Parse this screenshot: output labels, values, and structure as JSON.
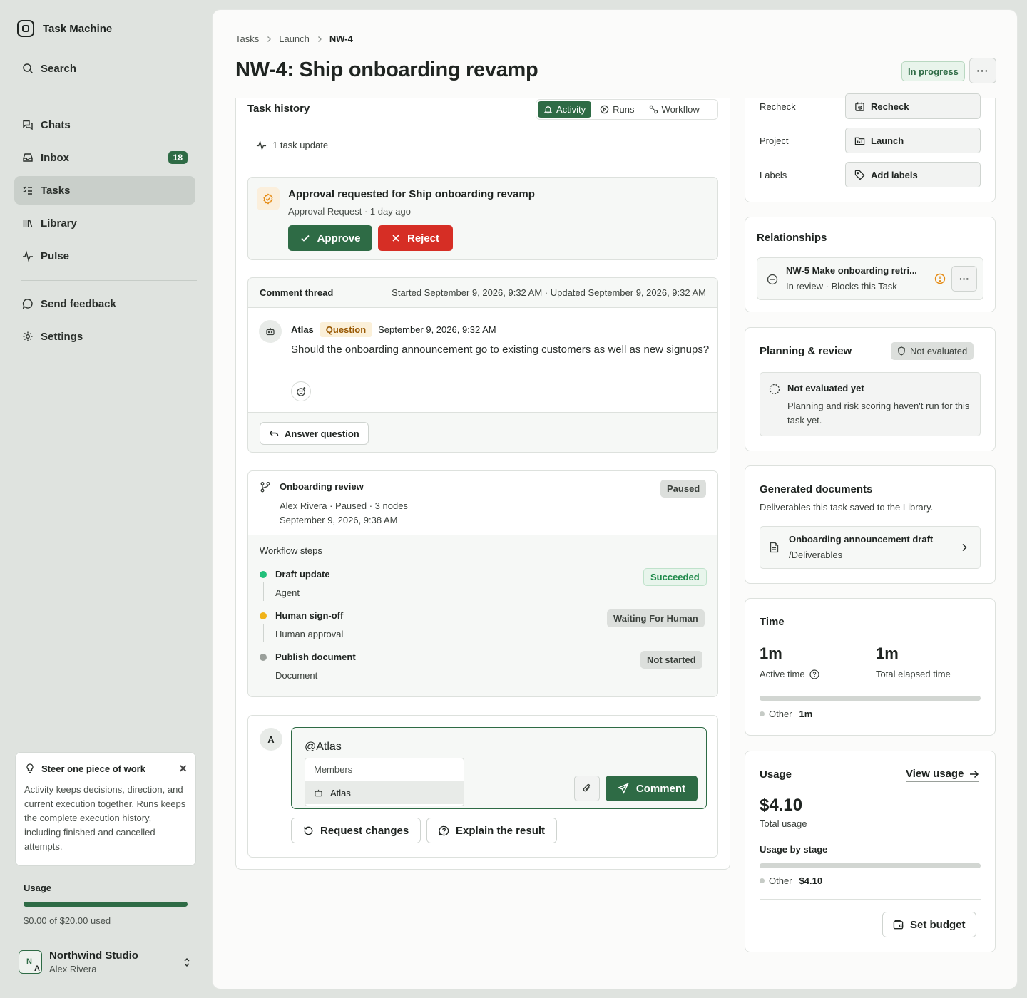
{
  "app": {
    "name": "Task Machine"
  },
  "sidebar": {
    "search_label": "Search",
    "items": [
      {
        "label": "Chats"
      },
      {
        "label": "Inbox",
        "badge": "18"
      },
      {
        "label": "Tasks"
      },
      {
        "label": "Library"
      },
      {
        "label": "Pulse"
      }
    ],
    "secondary": [
      {
        "label": "Send feedback"
      },
      {
        "label": "Settings"
      }
    ],
    "tip": {
      "title": "Steer one piece of work",
      "body": "Activity keeps decisions, direction, and current execution together. Runs keeps the complete execution history, including finished and cancelled attempts."
    },
    "usage": {
      "label": "Usage",
      "text": "$0.00 of $20.00 used",
      "fill": 1.0
    },
    "workspace": {
      "name": "Northwind Studio",
      "user": "Alex Rivera",
      "initial_1": "N",
      "initial_2": "A"
    }
  },
  "header": {
    "breadcrumbs": [
      "Tasks",
      "Launch",
      "NW-4"
    ],
    "title": "NW-4: Ship onboarding revamp",
    "status": "In progress",
    "more_label": "···"
  },
  "history": {
    "title": "Task history",
    "tabs": [
      {
        "label": "Activity"
      },
      {
        "label": "Runs"
      },
      {
        "label": "Workflow"
      }
    ],
    "update_count": "1 task update",
    "approval": {
      "title": "Approval requested for Ship onboarding revamp",
      "sub": "Approval Request · 1 day ago",
      "approve": "Approve",
      "reject": "Reject"
    },
    "thread": {
      "label": "Comment thread",
      "meta": "Started September 9, 2026, 9:32 AM · Updated September 9, 2026, 9:32 AM",
      "author": "Atlas",
      "tag": "Question",
      "time": "September 9, 2026, 9:32 AM",
      "text": "Should the onboarding announcement go to existing customers as well as new signups?",
      "answer_btn": "Answer question"
    },
    "workflow": {
      "title": "Onboarding review",
      "meta1": "Alex Rivera · Paused · 3 nodes",
      "meta2": "September 9, 2026, 9:38 AM",
      "status": "Paused",
      "steps_label": "Workflow steps",
      "steps": [
        {
          "name": "Draft update",
          "sub": "Agent",
          "status": "Succeeded",
          "color": "#22c07a"
        },
        {
          "name": "Human sign-off",
          "sub": "Human approval",
          "status": "Waiting For Human",
          "color": "#f0b318"
        },
        {
          "name": "Publish document",
          "sub": "Document",
          "status": "Not started",
          "color": "#9aa09b"
        }
      ]
    },
    "composer": {
      "avatar": "A",
      "value": "@Atlas",
      "mention_group": "Members",
      "mention_option": "Atlas",
      "comment_btn": "Comment",
      "request_changes": "Request changes",
      "explain": "Explain the result"
    }
  },
  "properties": {
    "rows": [
      {
        "label": "Recheck",
        "value": "Recheck"
      },
      {
        "label": "Project",
        "value": "Launch"
      },
      {
        "label": "Labels",
        "value": "Add labels"
      }
    ]
  },
  "relationships": {
    "title": "Relationships",
    "item_name": "NW-5 Make onboarding retri...",
    "item_sub": "In review · Blocks this Task",
    "more_label": "···"
  },
  "planning": {
    "title": "Planning & review",
    "badge": "Not evaluated",
    "box_title": "Not evaluated yet",
    "box_text": "Planning and risk scoring haven't run for this task yet."
  },
  "documents": {
    "title": "Generated documents",
    "sub": "Deliverables this task saved to the Library.",
    "doc_name": "Onboarding announcement draft",
    "doc_path": "/Deliverables"
  },
  "time": {
    "title": "Time",
    "active_value": "1m",
    "active_label": "Active time",
    "elapsed_value": "1m",
    "elapsed_label": "Total elapsed time",
    "legend_label": "Other",
    "legend_value": "1m"
  },
  "usage": {
    "title": "Usage",
    "link": "View usage",
    "total": "$4.10",
    "total_label": "Total usage",
    "by_stage": "Usage by stage",
    "legend_label": "Other",
    "legend_value": "$4.10",
    "budget_btn": "Set budget"
  },
  "colors": {
    "accent": "#2e6b45",
    "danger": "#d62e25",
    "warning": "#e58a12"
  }
}
